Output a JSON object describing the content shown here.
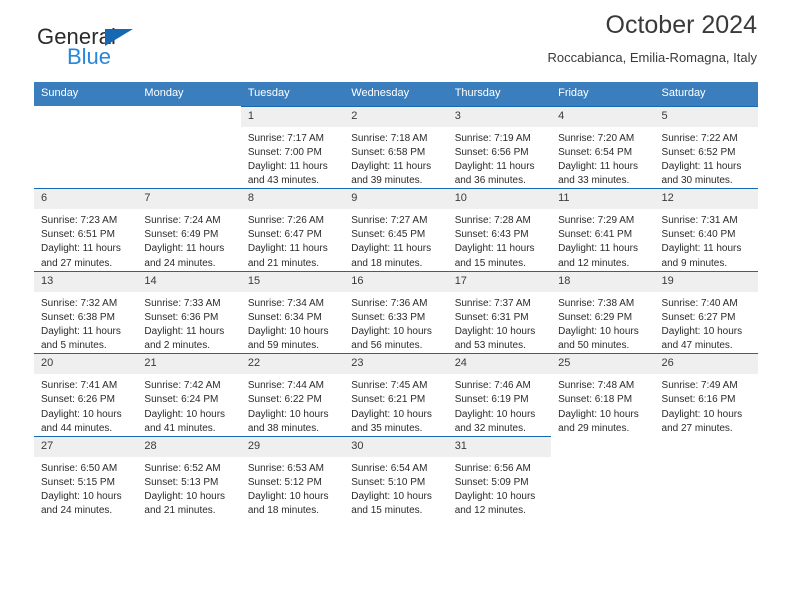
{
  "brand": {
    "name_part1": "General",
    "name_part2": "Blue",
    "triangle_color": "#1668b3",
    "blue_color": "#2a86d8"
  },
  "header": {
    "title": "October 2024",
    "subtitle": "Roccabianca, Emilia-Romagna, Italy"
  },
  "theme": {
    "header_bg": "#3a7ebd",
    "row_border": "#1668b3",
    "daynum_bg": "#efefef"
  },
  "weekday_headers": [
    "Sunday",
    "Monday",
    "Tuesday",
    "Wednesday",
    "Thursday",
    "Friday",
    "Saturday"
  ],
  "weeks": [
    [
      {
        "day": "",
        "blank": true,
        "lines": []
      },
      {
        "day": "",
        "blank": true,
        "lines": []
      },
      {
        "day": "1",
        "lines": [
          "Sunrise: 7:17 AM",
          "Sunset: 7:00 PM",
          "Daylight: 11 hours",
          "and 43 minutes."
        ]
      },
      {
        "day": "2",
        "lines": [
          "Sunrise: 7:18 AM",
          "Sunset: 6:58 PM",
          "Daylight: 11 hours",
          "and 39 minutes."
        ]
      },
      {
        "day": "3",
        "lines": [
          "Sunrise: 7:19 AM",
          "Sunset: 6:56 PM",
          "Daylight: 11 hours",
          "and 36 minutes."
        ]
      },
      {
        "day": "4",
        "lines": [
          "Sunrise: 7:20 AM",
          "Sunset: 6:54 PM",
          "Daylight: 11 hours",
          "and 33 minutes."
        ]
      },
      {
        "day": "5",
        "lines": [
          "Sunrise: 7:22 AM",
          "Sunset: 6:52 PM",
          "Daylight: 11 hours",
          "and 30 minutes."
        ]
      }
    ],
    [
      {
        "day": "6",
        "lines": [
          "Sunrise: 7:23 AM",
          "Sunset: 6:51 PM",
          "Daylight: 11 hours",
          "and 27 minutes."
        ]
      },
      {
        "day": "7",
        "lines": [
          "Sunrise: 7:24 AM",
          "Sunset: 6:49 PM",
          "Daylight: 11 hours",
          "and 24 minutes."
        ]
      },
      {
        "day": "8",
        "lines": [
          "Sunrise: 7:26 AM",
          "Sunset: 6:47 PM",
          "Daylight: 11 hours",
          "and 21 minutes."
        ]
      },
      {
        "day": "9",
        "lines": [
          "Sunrise: 7:27 AM",
          "Sunset: 6:45 PM",
          "Daylight: 11 hours",
          "and 18 minutes."
        ]
      },
      {
        "day": "10",
        "lines": [
          "Sunrise: 7:28 AM",
          "Sunset: 6:43 PM",
          "Daylight: 11 hours",
          "and 15 minutes."
        ]
      },
      {
        "day": "11",
        "lines": [
          "Sunrise: 7:29 AM",
          "Sunset: 6:41 PM",
          "Daylight: 11 hours",
          "and 12 minutes."
        ]
      },
      {
        "day": "12",
        "lines": [
          "Sunrise: 7:31 AM",
          "Sunset: 6:40 PM",
          "Daylight: 11 hours",
          "and 9 minutes."
        ]
      }
    ],
    [
      {
        "day": "13",
        "lines": [
          "Sunrise: 7:32 AM",
          "Sunset: 6:38 PM",
          "Daylight: 11 hours",
          "and 5 minutes."
        ]
      },
      {
        "day": "14",
        "lines": [
          "Sunrise: 7:33 AM",
          "Sunset: 6:36 PM",
          "Daylight: 11 hours",
          "and 2 minutes."
        ]
      },
      {
        "day": "15",
        "lines": [
          "Sunrise: 7:34 AM",
          "Sunset: 6:34 PM",
          "Daylight: 10 hours",
          "and 59 minutes."
        ]
      },
      {
        "day": "16",
        "lines": [
          "Sunrise: 7:36 AM",
          "Sunset: 6:33 PM",
          "Daylight: 10 hours",
          "and 56 minutes."
        ]
      },
      {
        "day": "17",
        "lines": [
          "Sunrise: 7:37 AM",
          "Sunset: 6:31 PM",
          "Daylight: 10 hours",
          "and 53 minutes."
        ]
      },
      {
        "day": "18",
        "lines": [
          "Sunrise: 7:38 AM",
          "Sunset: 6:29 PM",
          "Daylight: 10 hours",
          "and 50 minutes."
        ]
      },
      {
        "day": "19",
        "lines": [
          "Sunrise: 7:40 AM",
          "Sunset: 6:27 PM",
          "Daylight: 10 hours",
          "and 47 minutes."
        ]
      }
    ],
    [
      {
        "day": "20",
        "lines": [
          "Sunrise: 7:41 AM",
          "Sunset: 6:26 PM",
          "Daylight: 10 hours",
          "and 44 minutes."
        ]
      },
      {
        "day": "21",
        "lines": [
          "Sunrise: 7:42 AM",
          "Sunset: 6:24 PM",
          "Daylight: 10 hours",
          "and 41 minutes."
        ]
      },
      {
        "day": "22",
        "lines": [
          "Sunrise: 7:44 AM",
          "Sunset: 6:22 PM",
          "Daylight: 10 hours",
          "and 38 minutes."
        ]
      },
      {
        "day": "23",
        "lines": [
          "Sunrise: 7:45 AM",
          "Sunset: 6:21 PM",
          "Daylight: 10 hours",
          "and 35 minutes."
        ]
      },
      {
        "day": "24",
        "lines": [
          "Sunrise: 7:46 AM",
          "Sunset: 6:19 PM",
          "Daylight: 10 hours",
          "and 32 minutes."
        ]
      },
      {
        "day": "25",
        "lines": [
          "Sunrise: 7:48 AM",
          "Sunset: 6:18 PM",
          "Daylight: 10 hours",
          "and 29 minutes."
        ]
      },
      {
        "day": "26",
        "lines": [
          "Sunrise: 7:49 AM",
          "Sunset: 6:16 PM",
          "Daylight: 10 hours",
          "and 27 minutes."
        ]
      }
    ],
    [
      {
        "day": "27",
        "lines": [
          "Sunrise: 6:50 AM",
          "Sunset: 5:15 PM",
          "Daylight: 10 hours",
          "and 24 minutes."
        ]
      },
      {
        "day": "28",
        "lines": [
          "Sunrise: 6:52 AM",
          "Sunset: 5:13 PM",
          "Daylight: 10 hours",
          "and 21 minutes."
        ]
      },
      {
        "day": "29",
        "lines": [
          "Sunrise: 6:53 AM",
          "Sunset: 5:12 PM",
          "Daylight: 10 hours",
          "and 18 minutes."
        ]
      },
      {
        "day": "30",
        "lines": [
          "Sunrise: 6:54 AM",
          "Sunset: 5:10 PM",
          "Daylight: 10 hours",
          "and 15 minutes."
        ]
      },
      {
        "day": "31",
        "lines": [
          "Sunrise: 6:56 AM",
          "Sunset: 5:09 PM",
          "Daylight: 10 hours",
          "and 12 minutes."
        ]
      },
      {
        "day": "",
        "blank": true,
        "lines": []
      },
      {
        "day": "",
        "blank": true,
        "lines": []
      }
    ]
  ]
}
